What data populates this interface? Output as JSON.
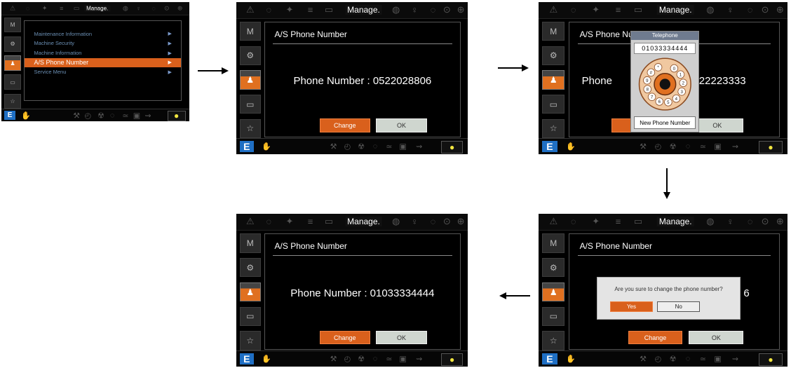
{
  "topbar": {
    "title": "Manage."
  },
  "sidebar": {
    "items": [
      "M",
      "⚙",
      "♟",
      "▭",
      "☆"
    ]
  },
  "bottombar": {
    "logo": "E",
    "hand": "✋",
    "turtle": "●"
  },
  "menu": {
    "items": [
      "Maintenance Information",
      "Machine Security",
      "Machine Information",
      "A/S Phone Number",
      "Service Menu"
    ],
    "selected_index": 3,
    "arrow": "▶"
  },
  "page": {
    "title": "A/S Phone Number",
    "phone_old": "Phone Number : 0522028806",
    "phone_new": "Phone Number : 01033334444",
    "change_label": "Change",
    "ok_label": "OK"
  },
  "telephone": {
    "header": "Telephone",
    "entered": "01033334444",
    "new_button": "New Phone Number",
    "dial_digits": [
      "0",
      "1",
      "2",
      "3",
      "4",
      "5",
      "6",
      "7",
      "8",
      "9",
      "#",
      "*"
    ],
    "partial_left": "Phone",
    "partial_right": "022223333",
    "partial_title": "A/S Phone Nu"
  },
  "confirm": {
    "question": "Are you sure to change the phone number?",
    "yes_label": "Yes",
    "no_label": "No",
    "partial": "6"
  },
  "colors": {
    "accent": "#d9601c",
    "menu_text": "#6b8fb4",
    "ok_button": "#cfd6cf"
  }
}
